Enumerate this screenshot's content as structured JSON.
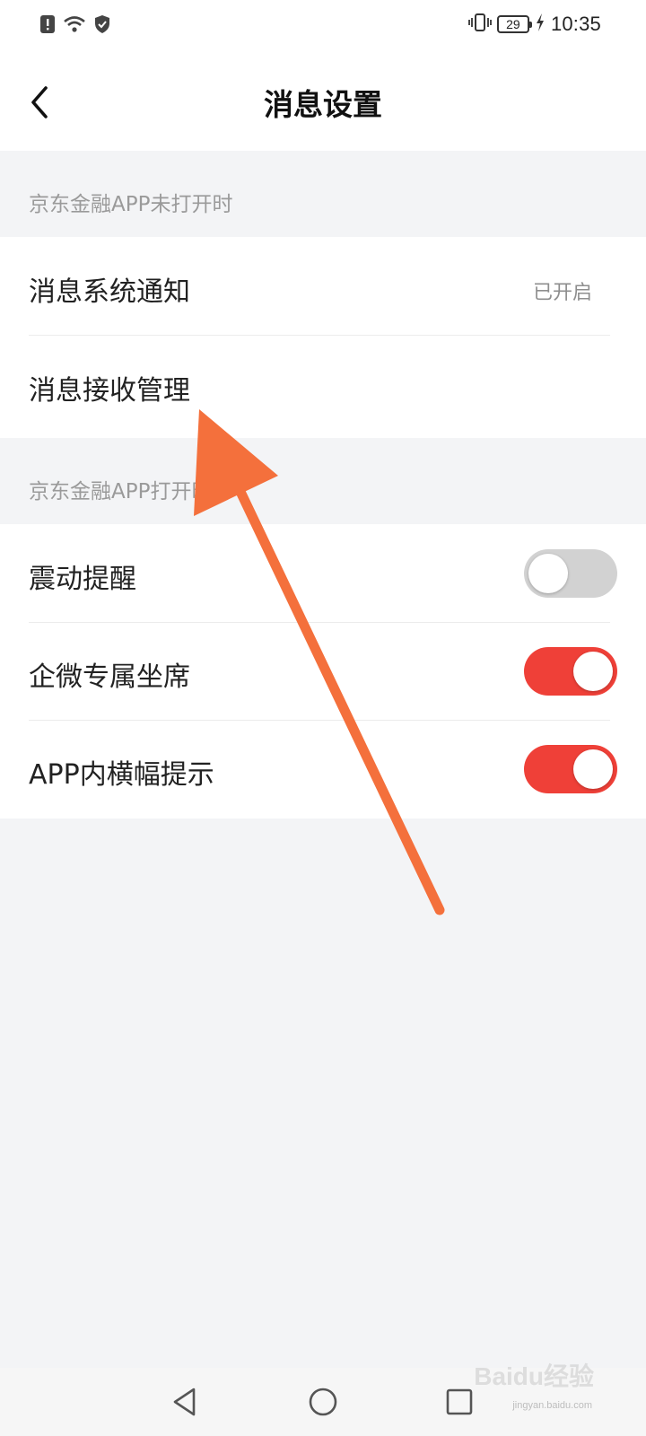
{
  "status_bar": {
    "time": "10:35",
    "battery_level": "29",
    "icons": [
      "alert-icon",
      "wifi-icon",
      "shield-icon",
      "vibrate-icon",
      "battery-icon",
      "charging-icon"
    ]
  },
  "header": {
    "title": "消息设置",
    "back_icon": "chevron-left-icon"
  },
  "sections": [
    {
      "header": "京东金融APP未打开时",
      "rows": [
        {
          "label": "消息系统通知",
          "value": "已开启"
        },
        {
          "label": "消息接收管理"
        }
      ]
    },
    {
      "header": "京东金融APP打开时",
      "rows": [
        {
          "label": "震动提醒",
          "toggle_on": false
        },
        {
          "label": "企微专属坐席",
          "toggle_on": true
        },
        {
          "label": "APP内横幅提示",
          "toggle_on": true
        }
      ]
    }
  ],
  "colors": {
    "accent_toggle_on": "#ef4038",
    "toggle_off": "#d2d2d2",
    "annotation_arrow": "#f4703c",
    "background": "#f3f4f6"
  },
  "nav_bar": {
    "icons": [
      "triangle-back-icon",
      "circle-home-icon",
      "square-recents-icon"
    ]
  },
  "watermark": {
    "brand": "Baidu经验",
    "sub": "jingyan.baidu.com"
  }
}
